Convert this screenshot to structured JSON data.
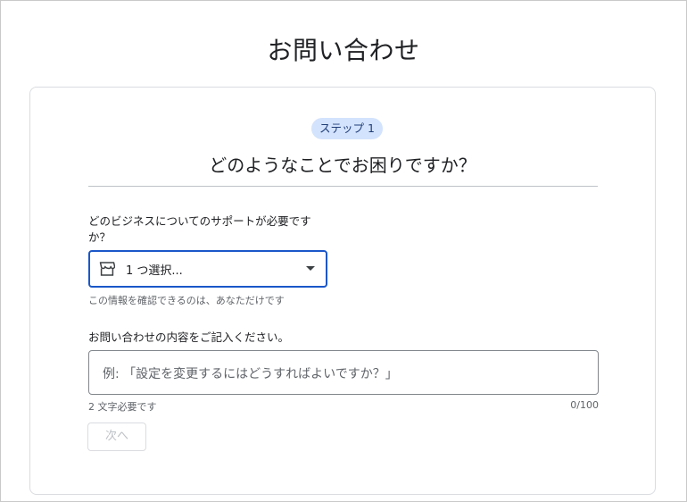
{
  "page": {
    "title": "お問い合わせ"
  },
  "step": {
    "label": "ステップ 1",
    "question": "どのようなことでお困りですか？"
  },
  "business": {
    "label": "どのビジネスについてのサポートが必要ですか？",
    "select_icon": "store-icon",
    "select_value": "1 つ選択...",
    "privacy_note": "この情報を確認できるのは、あなただけです"
  },
  "inquiry": {
    "label": "お問い合わせの内容をご記入ください。",
    "placeholder": "例: 「設定を変更するにはどうすればよいですか？」",
    "helper_text": "2 文字必要です",
    "char_count": "0/100"
  },
  "actions": {
    "next_label": "次へ"
  },
  "colors": {
    "accent_border": "#1a57c9",
    "step_pill_bg": "#d3e3fd",
    "step_pill_text": "#1f3d77",
    "disabled_text": "#bdc1c6"
  }
}
